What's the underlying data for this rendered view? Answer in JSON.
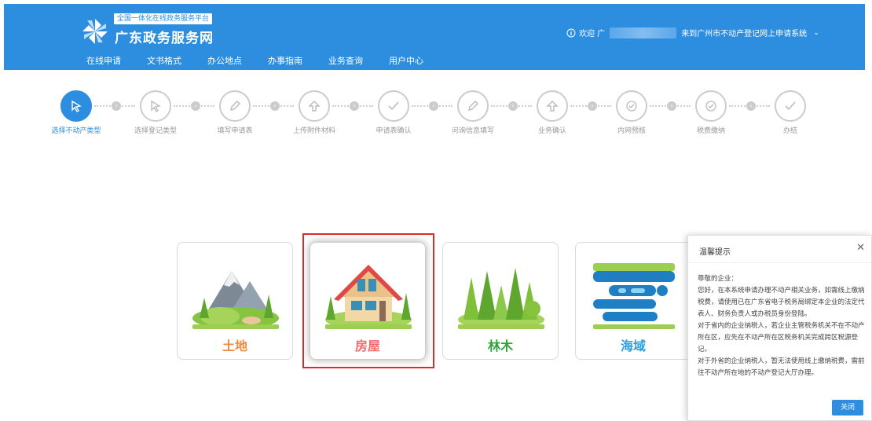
{
  "header": {
    "tagline": "全国一体化在线政务服务平台",
    "brand": "广东政务服务网",
    "welcome_prefix": "欢迎 广",
    "welcome_suffix": "来到广州市不动产登记网上申请系统",
    "nav": [
      "在线申请",
      "文书格式",
      "办公地点",
      "办事指南",
      "业务查询",
      "用户中心"
    ]
  },
  "steps": [
    "选择不动产类型",
    "选择登记类型",
    "填写申请表",
    "上传附件材料",
    "申请表确认",
    "问询信息填写",
    "业务确认",
    "内网预核",
    "税费缴纳",
    "办结"
  ],
  "cards": {
    "land": "土地",
    "house": "房屋",
    "forest": "林木",
    "sea": "海域"
  },
  "colors": {
    "primary": "#2d8ee0",
    "land_label": "#f08a3c",
    "house_label": "#f26a6a",
    "forest_label": "#2fa33b",
    "sea_label": "#2d9ee0",
    "highlight": "#d92b2b"
  },
  "dialog": {
    "title": "温馨提示",
    "greeting": "尊敬的企业：",
    "p1": "您好，在本系统申请办理不动产相关业务，如需线上缴纳税费，请使用已在广东省电子税务局绑定本企业的法定代表人、财务负责人或办税员身份登陆。",
    "p2": "对于省内的企业纳税人，若企业主管税务机关不在不动产所在区，应先在不动产所在区税务机关完成跨区税源登记。",
    "p3": "对于外省的企业纳税人，暂无法使用线上缴纳税费，需前往不动产所在地的不动产登记大厅办理。",
    "close_label": "关闭"
  }
}
